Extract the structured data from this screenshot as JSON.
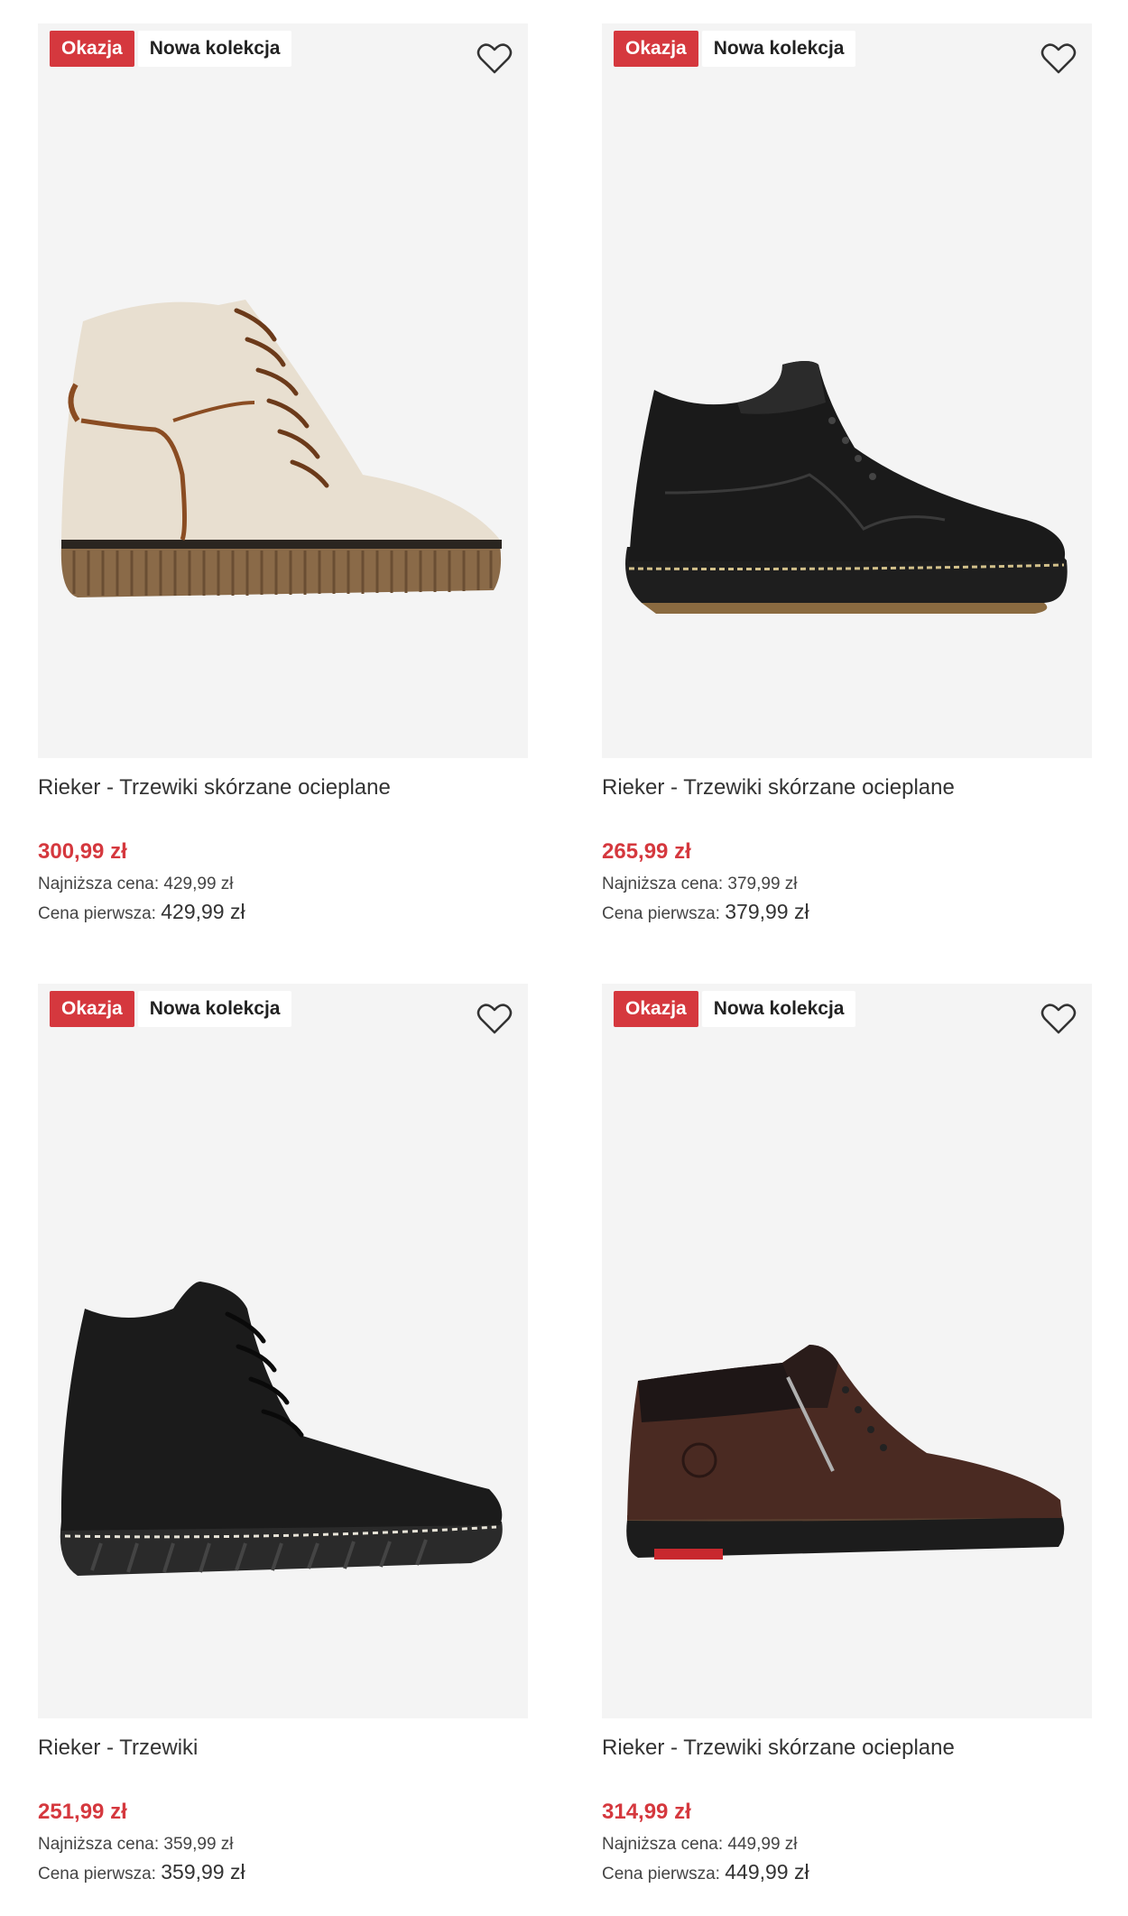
{
  "colors": {
    "accent": "#d5383e",
    "tile_bg": "#f4f4f4"
  },
  "products": [
    {
      "badges": [
        "Okazja",
        "Nowa kolekcja"
      ],
      "wishlist_icon": "heart-outline-icon",
      "title": "Rieker - Trzewiki skórzane ocieplane",
      "price": "300,99 zł",
      "lowest_label": "Najniższa cena:",
      "lowest_value": "429,99 zł",
      "first_label": "Cena pierwsza:",
      "first_value": "429,99 zł"
    },
    {
      "badges": [
        "Okazja",
        "Nowa kolekcja"
      ],
      "wishlist_icon": "heart-outline-icon",
      "title": "Rieker - Trzewiki skórzane ocieplane",
      "price": "265,99 zł",
      "lowest_label": "Najniższa cena:",
      "lowest_value": "379,99 zł",
      "first_label": "Cena pierwsza:",
      "first_value": "379,99 zł"
    },
    {
      "badges": [
        "Okazja",
        "Nowa kolekcja"
      ],
      "wishlist_icon": "heart-outline-icon",
      "title": "Rieker - Trzewiki",
      "price": "251,99 zł",
      "lowest_label": "Najniższa cena:",
      "lowest_value": "359,99 zł",
      "first_label": "Cena pierwsza:",
      "first_value": "359,99 zł"
    },
    {
      "badges": [
        "Okazja",
        "Nowa kolekcja"
      ],
      "wishlist_icon": "heart-outline-icon",
      "title": "Rieker - Trzewiki skórzane ocieplane",
      "price": "314,99 zł",
      "lowest_label": "Najniższa cena:",
      "lowest_value": "449,99 zł",
      "first_label": "Cena pierwsza:",
      "first_value": "449,99 zł"
    }
  ]
}
